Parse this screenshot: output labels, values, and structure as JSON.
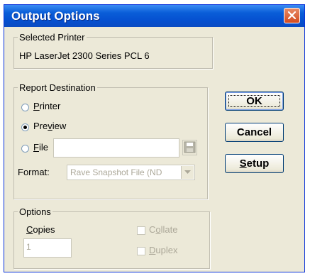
{
  "window": {
    "title": "Output Options"
  },
  "selected_printer": {
    "legend": "Selected Printer",
    "name": "HP LaserJet 2300 Series PCL 6"
  },
  "report_destination": {
    "legend": "Report Destination",
    "options": [
      {
        "label": "Printer",
        "mnemonic": "P",
        "rest": "rinter",
        "selected": false
      },
      {
        "label": "Preview",
        "mnemonic": "v",
        "pre": "Pre",
        "rest": "iew",
        "selected": true
      },
      {
        "label": "File",
        "mnemonic": "F",
        "rest": "ile",
        "selected": false
      }
    ],
    "file_value": "",
    "format_label": "Format:",
    "format_value": "Rave Snapshot File (ND"
  },
  "options": {
    "legend": "Options",
    "copies_label_mnemonic": "C",
    "copies_label_rest": "opies",
    "copies_value": "1",
    "collate_pre": "C",
    "collate_mnemonic": "o",
    "collate_rest": "llate",
    "duplex_mnemonic": "D",
    "duplex_rest": "uplex"
  },
  "buttons": {
    "ok": "OK",
    "cancel": "Cancel",
    "setup_mnemonic": "S",
    "setup_rest": "etup"
  },
  "colors": {
    "titlebar": "#0a5ed8",
    "dialog_bg": "#ece9d8",
    "close_button": "#d44a1f",
    "disabled_text": "#aca899"
  }
}
